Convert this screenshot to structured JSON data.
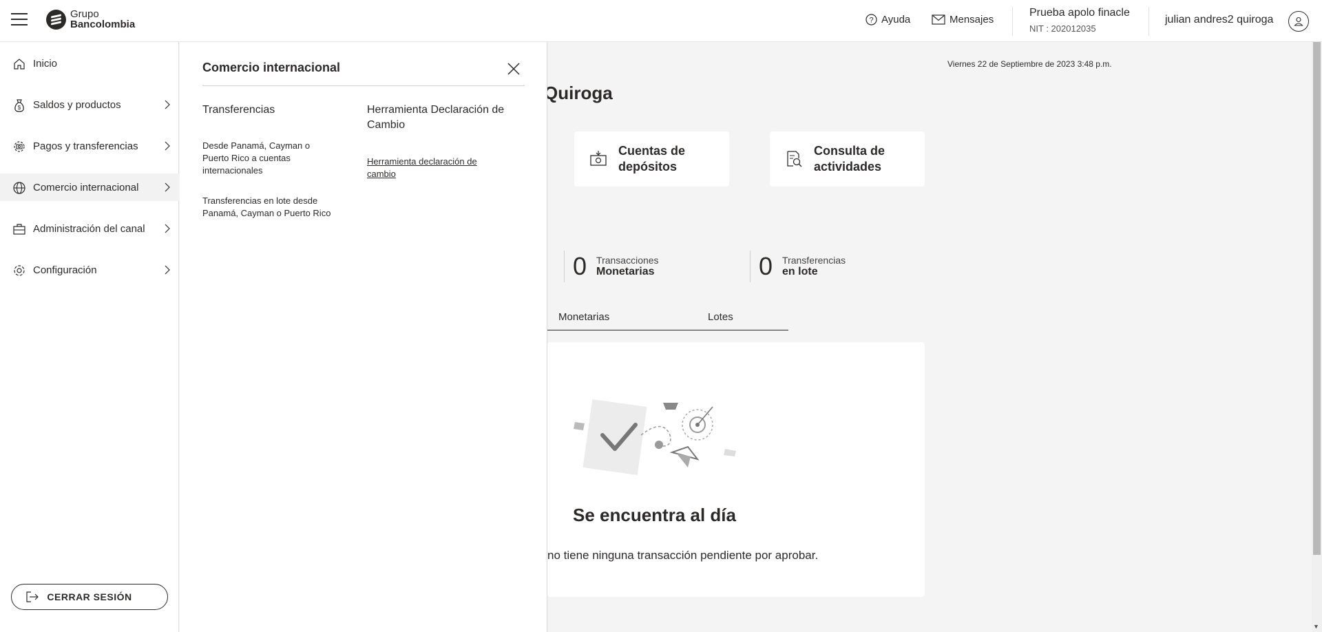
{
  "header": {
    "brand_line1": "Grupo",
    "brand_line2": "Bancolombia",
    "help_label": "Ayuda",
    "messages_label": "Mensajes",
    "company_name": "Prueba apolo finacle",
    "company_nit": "NIT : 202012035",
    "user_name": "julian andres2 quiroga"
  },
  "sidebar": {
    "items": [
      {
        "label": "Inicio",
        "icon": "home-icon"
      },
      {
        "label": "Saldos y productos",
        "icon": "money-bag-icon"
      },
      {
        "label": "Pagos y transferencias",
        "icon": "payments-icon"
      },
      {
        "label": "Comercio internacional",
        "icon": "globe-icon"
      },
      {
        "label": "Administración del canal",
        "icon": "briefcase-icon"
      },
      {
        "label": "Configuración",
        "icon": "gear-icon"
      }
    ],
    "logout_label": "CERRAR SESIÓN"
  },
  "submenu": {
    "title": "Comercio internacional",
    "col1_title": "Transferencias",
    "col1_links": [
      "Desde Panamá, Cayman o Puerto Rico a cuentas internacionales",
      "Transferencias en lote desde Panamá, Cayman o Puerto Rico"
    ],
    "col2_title": "Herramienta Declaración de Cambio",
    "col2_links": [
      "Herramienta declaración de cambio"
    ]
  },
  "main": {
    "date": "Viernes 22 de Septiembre de 2023 3:48 p.m.",
    "greeting": "Quiroga",
    "cards": [
      {
        "label": "Cuentas de depósitos",
        "icon": "deposit-icon"
      },
      {
        "label": "Consulta de actividades",
        "icon": "activity-search-icon"
      }
    ],
    "stats": [
      {
        "value": "0",
        "line1": "Transacciones",
        "line2": "Monetarias"
      },
      {
        "value": "0",
        "line1": "Transferencias",
        "line2": "en lote"
      }
    ],
    "tabs": [
      "Monetarias",
      "Lotes"
    ],
    "panel_title": "Se encuentra al día",
    "panel_text": "no tiene ninguna transacción pendiente por aprobar."
  }
}
